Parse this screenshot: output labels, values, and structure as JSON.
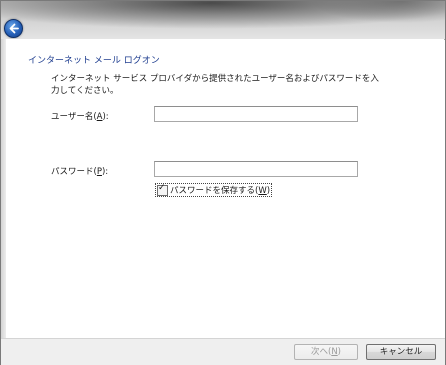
{
  "window": {
    "heading": "インターネット メール ログオン",
    "instructions": "インターネット サービス プロバイダから提供されたユーザー名およびパスワードを入力してください。"
  },
  "form": {
    "username": {
      "label": "ユーザー名(",
      "accel": "A",
      "label_end": "):",
      "value": ""
    },
    "password": {
      "label": "パスワード(",
      "accel": "P",
      "label_end": "):",
      "value": ""
    },
    "save_password": {
      "label": "パスワードを保存する(",
      "accel": "W",
      "label_end": ")",
      "checked": true
    }
  },
  "footer": {
    "next": {
      "label": "次へ(",
      "accel": "N",
      "label_end": ")",
      "enabled": false
    },
    "cancel": {
      "label": "キャンセル"
    }
  },
  "icons": {
    "back": "back-arrow-icon",
    "checkmark": "checkmark-icon"
  },
  "colors": {
    "heading": "#1e3d8f",
    "back_button": "#2560b8"
  }
}
